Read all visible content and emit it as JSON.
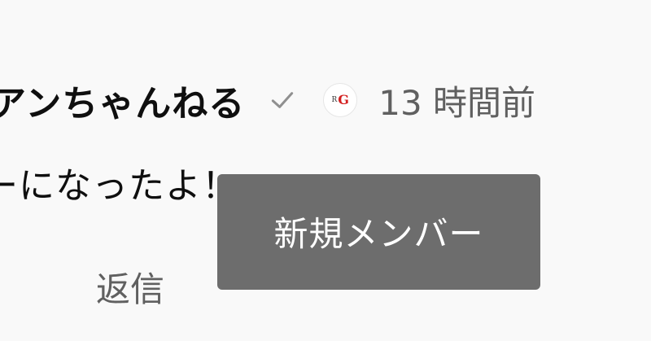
{
  "comment": {
    "author": "アンちゃんねる",
    "verified_icon": "check-icon",
    "member_badge_icon": "member-badge-icon",
    "member_badge_text": "RG",
    "timestamp": "13 時間前",
    "text": "ーになったよ！",
    "reply_label": "返信"
  },
  "tooltip": {
    "text": "新規メンバー"
  },
  "colors": {
    "background": "#f9f9f9",
    "primary_text": "#0f0f0f",
    "secondary_text": "#606060",
    "tooltip_bg": "#616161",
    "badge_red": "#d42020"
  }
}
